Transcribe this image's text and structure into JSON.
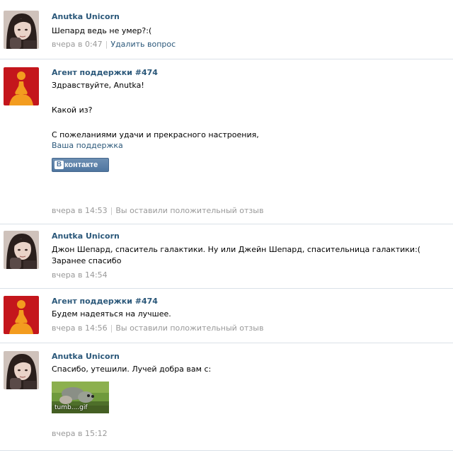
{
  "messages": [
    {
      "author": "Anutka Unicorn",
      "avatar": "user-avatar-icon",
      "lines": [
        "Шепард ведь не умер?:("
      ],
      "time": "вчера в 0:47",
      "action": "Удалить вопрос"
    },
    {
      "author": "Агент поддержки #474",
      "avatar": "support-agent-avatar-icon",
      "lines": [
        "Здравствуйте, Anutka!",
        "Какой из?",
        "С пожеланиями удачи и прекрасного настроения,"
      ],
      "signature_link": "Ваша поддержка",
      "badge": {
        "mark": "В",
        "label": "контакте"
      },
      "time": "вчера в 14:53",
      "status": "Вы оставили положительный отзыв"
    },
    {
      "author": "Anutka Unicorn",
      "avatar": "user-avatar-icon",
      "lines": [
        "Джон Шепард, спаситель галактики. Ну или Джейн Шепард, спасительница галактики:(",
        "Заранее спасибо"
      ],
      "time": "вчера в 14:54"
    },
    {
      "author": "Агент поддержки #474",
      "avatar": "support-agent-avatar-icon",
      "lines": [
        "Будем надеяться на лучшее."
      ],
      "time": "вчера в 14:56",
      "status": "Вы оставили положительный отзыв"
    },
    {
      "author": "Anutka Unicorn",
      "avatar": "user-avatar-icon",
      "lines": [
        "Спасибо, утешили. Лучей добра вам с:"
      ],
      "attachment": {
        "label": "tumb....gif"
      },
      "time": "вчера в 15:12"
    }
  ],
  "colors": {
    "link": "#2b587a",
    "meta": "#999999",
    "divider": "#dae1e8",
    "support_avatar_bg": "#c4161c",
    "support_avatar_figure": "#f39c1f"
  }
}
